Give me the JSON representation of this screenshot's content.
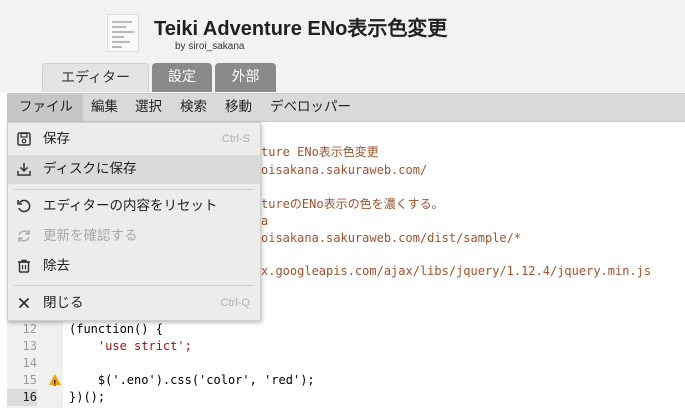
{
  "header": {
    "title": "Teiki Adventure ENo表示色変更",
    "author": "by siroi_sakana"
  },
  "tabs": [
    {
      "label": "エディター",
      "active": true
    },
    {
      "label": "設定",
      "active": false
    },
    {
      "label": "外部",
      "active": false
    }
  ],
  "menubar": [
    "ファイル",
    "編集",
    "選択",
    "検索",
    "移動",
    "デベロッパー"
  ],
  "file_menu": {
    "items": [
      {
        "label": "保存",
        "shortcut": "Ctrl-S",
        "icon": "save-icon",
        "disabled": false
      },
      {
        "label": "ディスクに保存",
        "shortcut": "",
        "icon": "download-icon",
        "disabled": false
      },
      {
        "label": "エディターの内容をリセット",
        "shortcut": "",
        "icon": "reset-icon",
        "disabled": false
      },
      {
        "label": "更新を確認する",
        "shortcut": "",
        "icon": "refresh-icon",
        "disabled": true
      },
      {
        "label": "除去",
        "shortcut": "",
        "icon": "trash-icon",
        "disabled": false
      },
      {
        "label": "閉じる",
        "shortcut": "Ctrl-Q",
        "icon": "close-icon",
        "disabled": false
      }
    ]
  },
  "editor": {
    "visible_fragments": [
      "ture ENo表示色変更",
      "oisakana.sakuraweb.com/",
      "tureのENo表示の色を濃くする。",
      "a",
      "oisakana.sakuraweb.com/dist/sample/*",
      "x.googleapis.com/ajax/libs/jquery/1.12.4/jquery.min.js"
    ],
    "lines": [
      {
        "num": "12",
        "text": "(function() {"
      },
      {
        "num": "13",
        "text": "    'use strict';"
      },
      {
        "num": "14",
        "text": ""
      },
      {
        "num": "15",
        "text": "    $('.eno').css('color', 'red');",
        "warning": true
      },
      {
        "num": "16",
        "text": "})();",
        "active": true
      }
    ]
  },
  "colors": {
    "header_bg": "#f2f2f2",
    "tab_inactive": "#8a8a8a",
    "menubar_bg": "#d9d9d9",
    "comment": "#a0522d",
    "warning": "#f0a30a"
  }
}
